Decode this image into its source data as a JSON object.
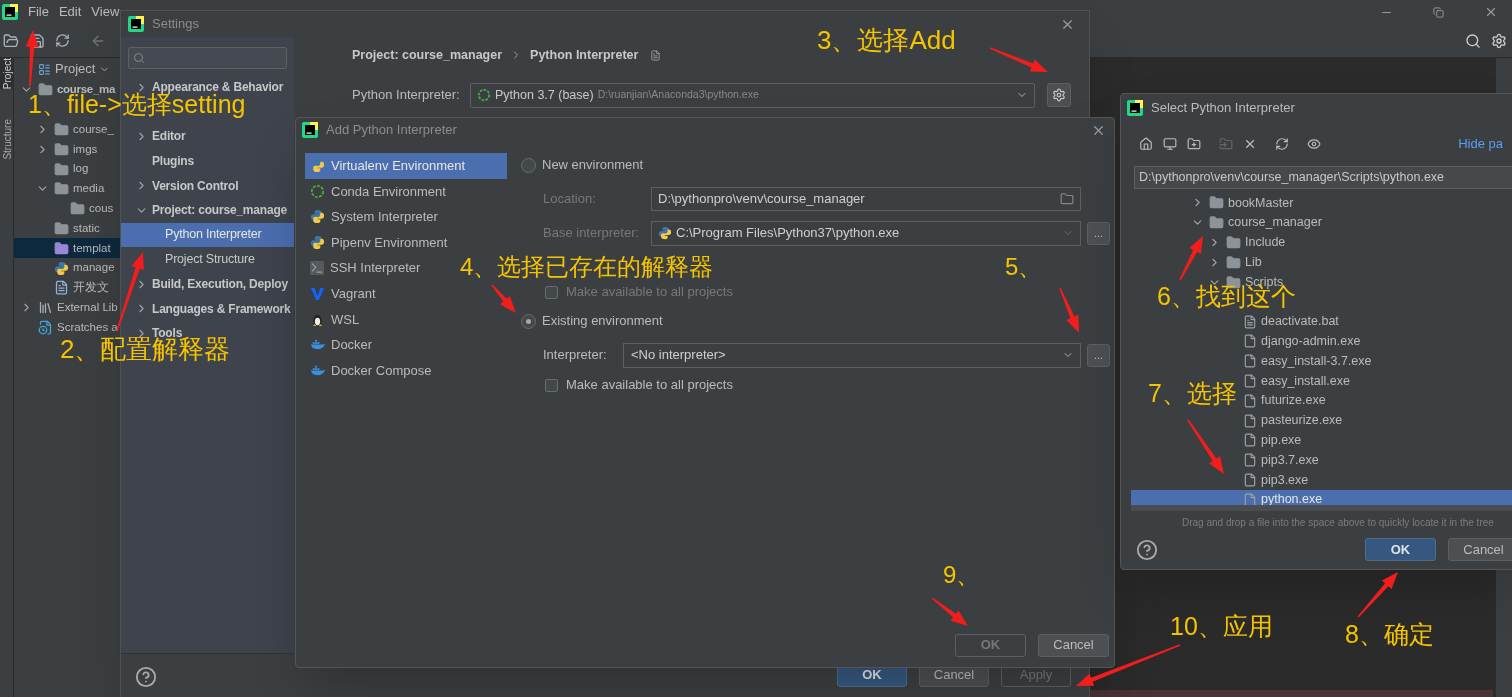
{
  "ide": {
    "menu": [
      "File",
      "Edit",
      "View"
    ],
    "tool_windows": [
      {
        "label": "Project",
        "selected": true
      },
      {
        "label": "Structure",
        "selected": false
      }
    ],
    "project_panel": {
      "title": "Project",
      "tree": [
        {
          "label": "course_ma",
          "kind": "folder",
          "expanded": true,
          "selected": false,
          "children": [
            {
              "label": "course_",
              "kind": "folder",
              "expanded": false,
              "selected": false,
              "hidden_row_above": true
            },
            {
              "label": "imgs",
              "kind": "folder",
              "expanded": false,
              "selected": false
            },
            {
              "label": "log",
              "kind": "folder",
              "selected": false
            },
            {
              "label": "media",
              "kind": "folder",
              "expanded": true,
              "selected": false,
              "children": [
                {
                  "label": "cous",
                  "kind": "folder",
                  "selected": false
                }
              ]
            },
            {
              "label": "static",
              "kind": "folder",
              "selected": false
            },
            {
              "label": "templat",
              "kind": "template_folder",
              "selected": true
            },
            {
              "label": "manage",
              "kind": "python_file",
              "selected": false
            },
            {
              "label": "开发文",
              "kind": "doc_file",
              "selected": false
            }
          ]
        },
        {
          "label": "External Lib",
          "kind": "library",
          "expanded": false,
          "selected": false
        },
        {
          "label": "Scratches a",
          "kind": "scratch",
          "selected": false
        }
      ]
    }
  },
  "settings": {
    "title": "Settings",
    "nav": [
      {
        "label": "Appearance & Behavior",
        "expanded": false,
        "selected": false
      },
      {
        "label": "Editor",
        "expanded": false,
        "selected": false,
        "hidden_row_above": true
      },
      {
        "label": "Plugins",
        "selected": false
      },
      {
        "label": "Version Control",
        "expanded": false,
        "selected": false
      },
      {
        "label": "Project: course_manage",
        "expanded": true,
        "selected": false,
        "children": [
          {
            "label": "Python Interpreter",
            "selected": true
          },
          {
            "label": "Project Structure",
            "selected": false
          }
        ]
      },
      {
        "label": "Build, Execution, Deploy",
        "expanded": false,
        "selected": false
      },
      {
        "label": "Languages & Framework",
        "expanded": false,
        "selected": false
      },
      {
        "label": "Tools",
        "expanded": false,
        "selected": false
      }
    ],
    "breadcrumb": [
      "Project: course_manager",
      "Python Interpreter"
    ],
    "interpreter": {
      "label": "Python Interpreter:",
      "value": "Python 3.7 (base)",
      "path": "D:\\ruanjian\\Anaconda3\\python.exe"
    },
    "buttons": [
      {
        "label": "OK",
        "kind": "primary",
        "disabled": false
      },
      {
        "label": "Cancel",
        "kind": "normal",
        "disabled": false
      },
      {
        "label": "Apply",
        "kind": "normal",
        "disabled": true
      }
    ]
  },
  "add_interpreter": {
    "title": "Add Python Interpreter",
    "types": [
      {
        "label": "Virtualenv Environment",
        "kind": "virtualenv",
        "selected": true
      },
      {
        "label": "Conda Environment",
        "kind": "conda",
        "selected": false
      },
      {
        "label": "System Interpreter",
        "kind": "python",
        "selected": false
      },
      {
        "label": "Pipenv Environment",
        "kind": "pipenv",
        "selected": false
      },
      {
        "label": "SSH Interpreter",
        "kind": "ssh",
        "selected": false
      },
      {
        "label": "Vagrant",
        "kind": "vagrant",
        "selected": false
      },
      {
        "label": "WSL",
        "kind": "wsl",
        "selected": false
      },
      {
        "label": "Docker",
        "kind": "docker",
        "selected": false
      },
      {
        "label": "Docker Compose",
        "kind": "docker",
        "selected": false
      }
    ],
    "new_environment": {
      "label": "New environment",
      "selected": false,
      "location_label": "Location:",
      "location": "D:\\pythonpro\\venv\\course_manager",
      "base_label": "Base interpreter:",
      "base": "C:\\Program Files\\Python37\\python.exe",
      "base_browse": "...",
      "make_available": {
        "label": "Make available to all projects",
        "checked": false
      }
    },
    "existing_environment": {
      "label": "Existing environment",
      "selected": true,
      "interpreter_label": "Interpreter:",
      "interpreter": "<No interpreter>",
      "browse": "...",
      "make_available": {
        "label": "Make available to all projects",
        "checked": false
      }
    },
    "buttons": [
      {
        "label": "OK",
        "kind": "primary",
        "disabled": true
      },
      {
        "label": "Cancel",
        "kind": "normal",
        "disabled": false
      }
    ]
  },
  "select_interpreter": {
    "title": "Select Python Interpreter",
    "hide_path": "Hide pa",
    "path": "D:\\pythonpro\\venv\\course_manager\\Scripts\\python.exe",
    "tree": [
      {
        "label": "bookMaster",
        "kind": "folder",
        "expanded": false,
        "selected": false
      },
      {
        "label": "course_manager",
        "kind": "folder",
        "expanded": true,
        "selected": false,
        "children": [
          {
            "label": "Include",
            "kind": "folder",
            "expanded": false,
            "selected": false
          },
          {
            "label": "Lib",
            "kind": "folder",
            "expanded": false,
            "selected": false
          },
          {
            "label": "Scripts",
            "kind": "folder",
            "expanded": true,
            "selected": false,
            "children": [
              {
                "label": "deactivate.bat",
                "kind": "bat",
                "selected": false,
                "hidden_row_above": true
              },
              {
                "label": "django-admin.exe",
                "kind": "exe",
                "selected": false
              },
              {
                "label": "easy_install-3.7.exe",
                "kind": "exe",
                "selected": false
              },
              {
                "label": "easy_install.exe",
                "kind": "exe",
                "selected": false
              },
              {
                "label": "futurize.exe",
                "kind": "exe",
                "selected": false
              },
              {
                "label": "pasteurize.exe",
                "kind": "exe",
                "selected": false
              },
              {
                "label": "pip.exe",
                "kind": "exe",
                "selected": false
              },
              {
                "label": "pip3.7.exe",
                "kind": "exe",
                "selected": false
              },
              {
                "label": "pip3.exe",
                "kind": "exe",
                "selected": false
              },
              {
                "label": "python.exe",
                "kind": "exe",
                "selected": true
              }
            ]
          }
        ]
      }
    ],
    "hint": "Drag and drop a file into the space above to quickly locate it in the tree",
    "buttons": [
      {
        "label": "OK",
        "kind": "primary",
        "disabled": false
      },
      {
        "label": "Cancel",
        "kind": "normal",
        "disabled": false
      }
    ]
  },
  "annotations": [
    {
      "text": "1、file->选择setting"
    },
    {
      "text": "2、配置解释器"
    },
    {
      "text": "3、选择Add"
    },
    {
      "text": "4、选择已存在的解释器"
    },
    {
      "text": "5、"
    },
    {
      "text": "6、找到这个"
    },
    {
      "text": "7、选择"
    },
    {
      "text": "8、确定"
    },
    {
      "text": "9、"
    },
    {
      "text": "10、应用"
    }
  ]
}
